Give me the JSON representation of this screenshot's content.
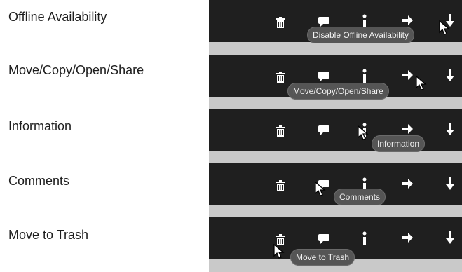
{
  "rows": [
    {
      "label": "Offline Availability",
      "tooltip": "Disable Offline Availability"
    },
    {
      "label": "Move/Copy/Open/Share",
      "tooltip": "Move/Copy/Open/Share"
    },
    {
      "label": "Information",
      "tooltip": "Information"
    },
    {
      "label": "Comments",
      "tooltip": "Comments"
    },
    {
      "label": "Move to Trash",
      "tooltip": "Move to Trash"
    }
  ],
  "toolbar_icons": [
    "trash-icon",
    "comment-icon",
    "info-icon",
    "arrow-right-icon",
    "arrow-down-icon"
  ],
  "colors": {
    "toolbar": "#1f1f1f",
    "separator": "#c9c9c9",
    "tooltip": "#555555",
    "icon": "#ffffff"
  }
}
